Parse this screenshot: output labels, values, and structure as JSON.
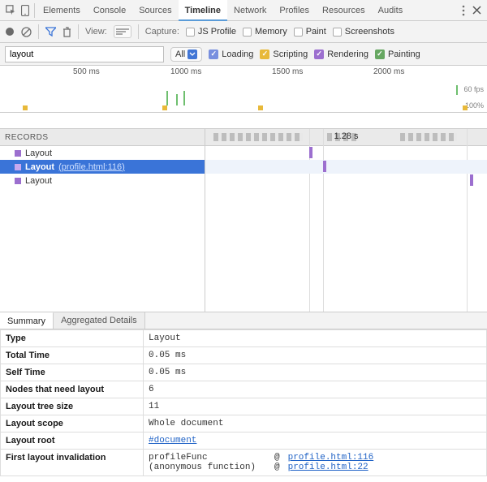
{
  "tabs": {
    "elements": "Elements",
    "console": "Console",
    "sources": "Sources",
    "timeline": "Timeline",
    "network": "Network",
    "profiles": "Profiles",
    "resources": "Resources",
    "audits": "Audits"
  },
  "toolbar": {
    "view_label": "View:",
    "capture_label": "Capture:",
    "jsprofile": "JS Profile",
    "memory": "Memory",
    "paint": "Paint",
    "screenshots": "Screenshots"
  },
  "filter": {
    "value": "layout",
    "dropdown": "All",
    "loading": "Loading",
    "scripting": "Scripting",
    "rendering": "Rendering",
    "painting": "Painting"
  },
  "overview": {
    "ticks": [
      "500 ms",
      "1000 ms",
      "1500 ms",
      "2000 ms"
    ],
    "fps_label": "60 fps",
    "pct_label": "100%"
  },
  "records": {
    "header": "RECORDS",
    "duration": "1.28 s",
    "items": [
      {
        "label": "Layout",
        "link": "",
        "selected": false
      },
      {
        "label": "Layout",
        "link": "(profile.html:116)",
        "selected": true
      },
      {
        "label": "Layout",
        "link": "",
        "selected": false
      }
    ]
  },
  "summary_tabs": {
    "summary": "Summary",
    "aggregated": "Aggregated Details"
  },
  "detail": {
    "rows": {
      "type": {
        "label": "Type",
        "value": "Layout"
      },
      "total_time": {
        "label": "Total Time",
        "value": "0.05 ms"
      },
      "self_time": {
        "label": "Self Time",
        "value": "0.05 ms"
      },
      "nodes": {
        "label": "Nodes that need layout",
        "value": "6"
      },
      "tree_size": {
        "label": "Layout tree size",
        "value": "11"
      },
      "scope": {
        "label": "Layout scope",
        "value": "Whole document"
      },
      "root": {
        "label": "Layout root",
        "value": "#document"
      },
      "first_inval": {
        "label": "First layout invalidation"
      }
    },
    "stack": [
      {
        "fn": "profileFunc",
        "at": "@",
        "link": "profile.html:116"
      },
      {
        "fn": "(anonymous function)",
        "at": "@",
        "link": "profile.html:22"
      }
    ]
  }
}
